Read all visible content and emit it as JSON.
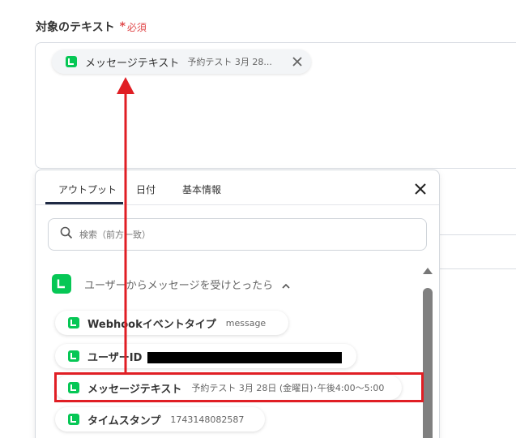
{
  "field": {
    "label": "対象のテキスト",
    "required_mark": "*",
    "required_text": "必須"
  },
  "chip": {
    "label": "メッセージテキスト",
    "value": "予約テスト 3月 28..."
  },
  "popup": {
    "tabs": [
      {
        "label": "アウトプット",
        "active": true
      },
      {
        "label": "日付",
        "active": false
      },
      {
        "label": "基本情報",
        "active": false
      }
    ],
    "search_placeholder": "検索（前方一致）",
    "group_title": "ユーザーからメッセージを受けとったら",
    "items": [
      {
        "label": "Webhookイベントタイプ",
        "value": "message"
      },
      {
        "label": "ユーザーID",
        "value": ""
      },
      {
        "label": "メッセージテキスト",
        "value": "予約テスト 3月 28日 (金曜日)･午後4:00〜5:00"
      },
      {
        "label": "タイムスタンプ",
        "value": "1743148082587"
      }
    ]
  },
  "colors": {
    "accent": "#06c755",
    "highlight": "#e01e24",
    "required": "#e0484a"
  }
}
